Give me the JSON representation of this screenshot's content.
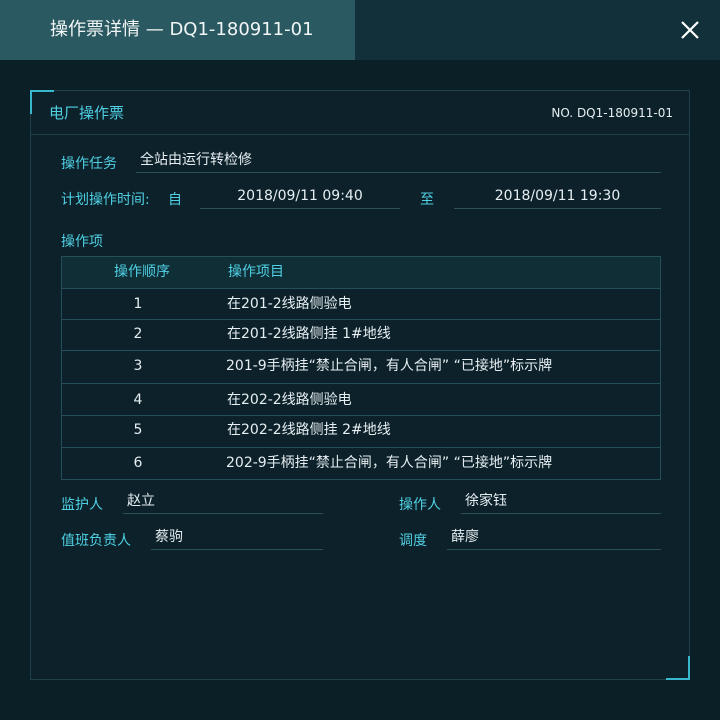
{
  "window": {
    "title": "操作票详情 — DQ1-180911-01",
    "close_icon": "close-icon"
  },
  "ticket": {
    "title": "电厂操作票",
    "number": "NO. DQ1-180911-01",
    "task_label": "操作任务",
    "task_value": "全站由运行转检修",
    "time_label": "计划操作时间:",
    "from_label": "自",
    "from_value": "2018/09/11 09:40",
    "to_label": "至",
    "to_value": "2018/09/11 19:30",
    "items_label": "操作项"
  },
  "table": {
    "headers": [
      "操作顺序",
      "操作项目"
    ],
    "rows": [
      {
        "no": "1",
        "item": "在201-2线路侧验电"
      },
      {
        "no": "2",
        "item": "在201-2线路侧挂 1#地线"
      },
      {
        "no": "3",
        "item": "201-9手柄挂“禁止合闸，有人合闸” “已接地”标示牌"
      },
      {
        "no": "4",
        "item": "在202-2线路侧验电"
      },
      {
        "no": "5",
        "item": "在202-2线路侧挂 2#地线"
      },
      {
        "no": "6",
        "item": "202-9手柄挂“禁止合闸，有人合闸” “已接地”标示牌"
      }
    ]
  },
  "people": {
    "supervisor_label": "监护人",
    "supervisor_value": "赵立",
    "operator_label": "操作人",
    "operator_value": "徐家钰",
    "duty_label": "值班负责人",
    "duty_value": "蔡驹",
    "dispatch_label": "调度",
    "dispatch_value": "薛廖"
  },
  "colors": {
    "accent": "#4fd0e4",
    "background": "#0b1f27",
    "title_tab": "#2a5961"
  }
}
